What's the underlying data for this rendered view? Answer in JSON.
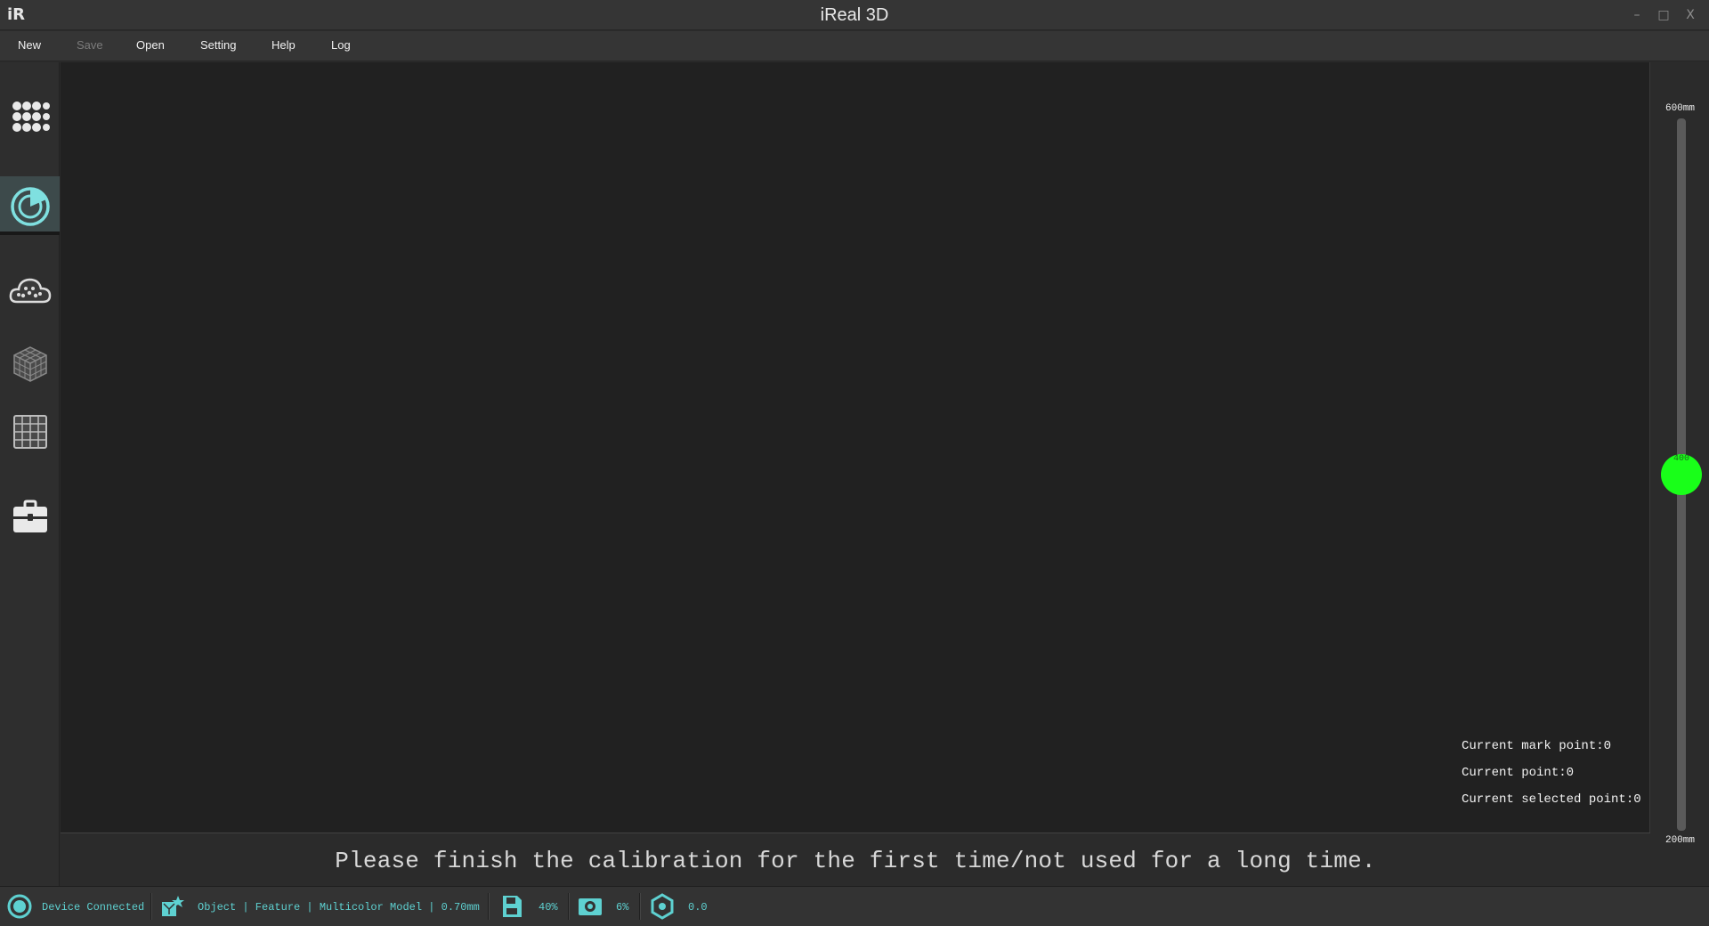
{
  "window": {
    "title": "iReal 3D",
    "logo": "iR",
    "minimize_glyph": "–",
    "maximize_glyph": "□",
    "close_glyph": "X"
  },
  "menu": {
    "items": [
      {
        "label": "New",
        "enabled": true
      },
      {
        "label": "Save",
        "enabled": false
      },
      {
        "label": "Open",
        "enabled": true
      },
      {
        "label": "Setting",
        "enabled": true
      },
      {
        "label": "Help",
        "enabled": true
      },
      {
        "label": "Log",
        "enabled": true
      }
    ]
  },
  "sidebar": {
    "items": [
      {
        "icon": "dots-grid-icon",
        "active": false
      },
      {
        "icon": "scan-target-icon",
        "active": true
      },
      {
        "icon": "point-cloud-icon",
        "active": false
      },
      {
        "icon": "mesh-cube-icon",
        "active": false
      },
      {
        "icon": "grid-table-icon",
        "active": false
      },
      {
        "icon": "toolbox-icon",
        "active": false
      }
    ]
  },
  "viewport": {
    "point_info": {
      "mark_point": "Current mark point:0",
      "point": "Current point:0",
      "selected_point": "Current selected point:0"
    }
  },
  "message": "Please finish the calibration for the first time/not used for a long time.",
  "distance_slider": {
    "max_label": "600mm",
    "min_label": "200mm",
    "value": 400,
    "value_label": "400",
    "range": [
      200,
      600
    ],
    "thumb_color": "#19ff19"
  },
  "status": {
    "device": "Device Connected",
    "mode": "Object | Feature | Multicolor Model | 0.70mm",
    "memory": "40%",
    "camera": "6%",
    "other": "0.0",
    "accent": "#5ed1d1"
  }
}
